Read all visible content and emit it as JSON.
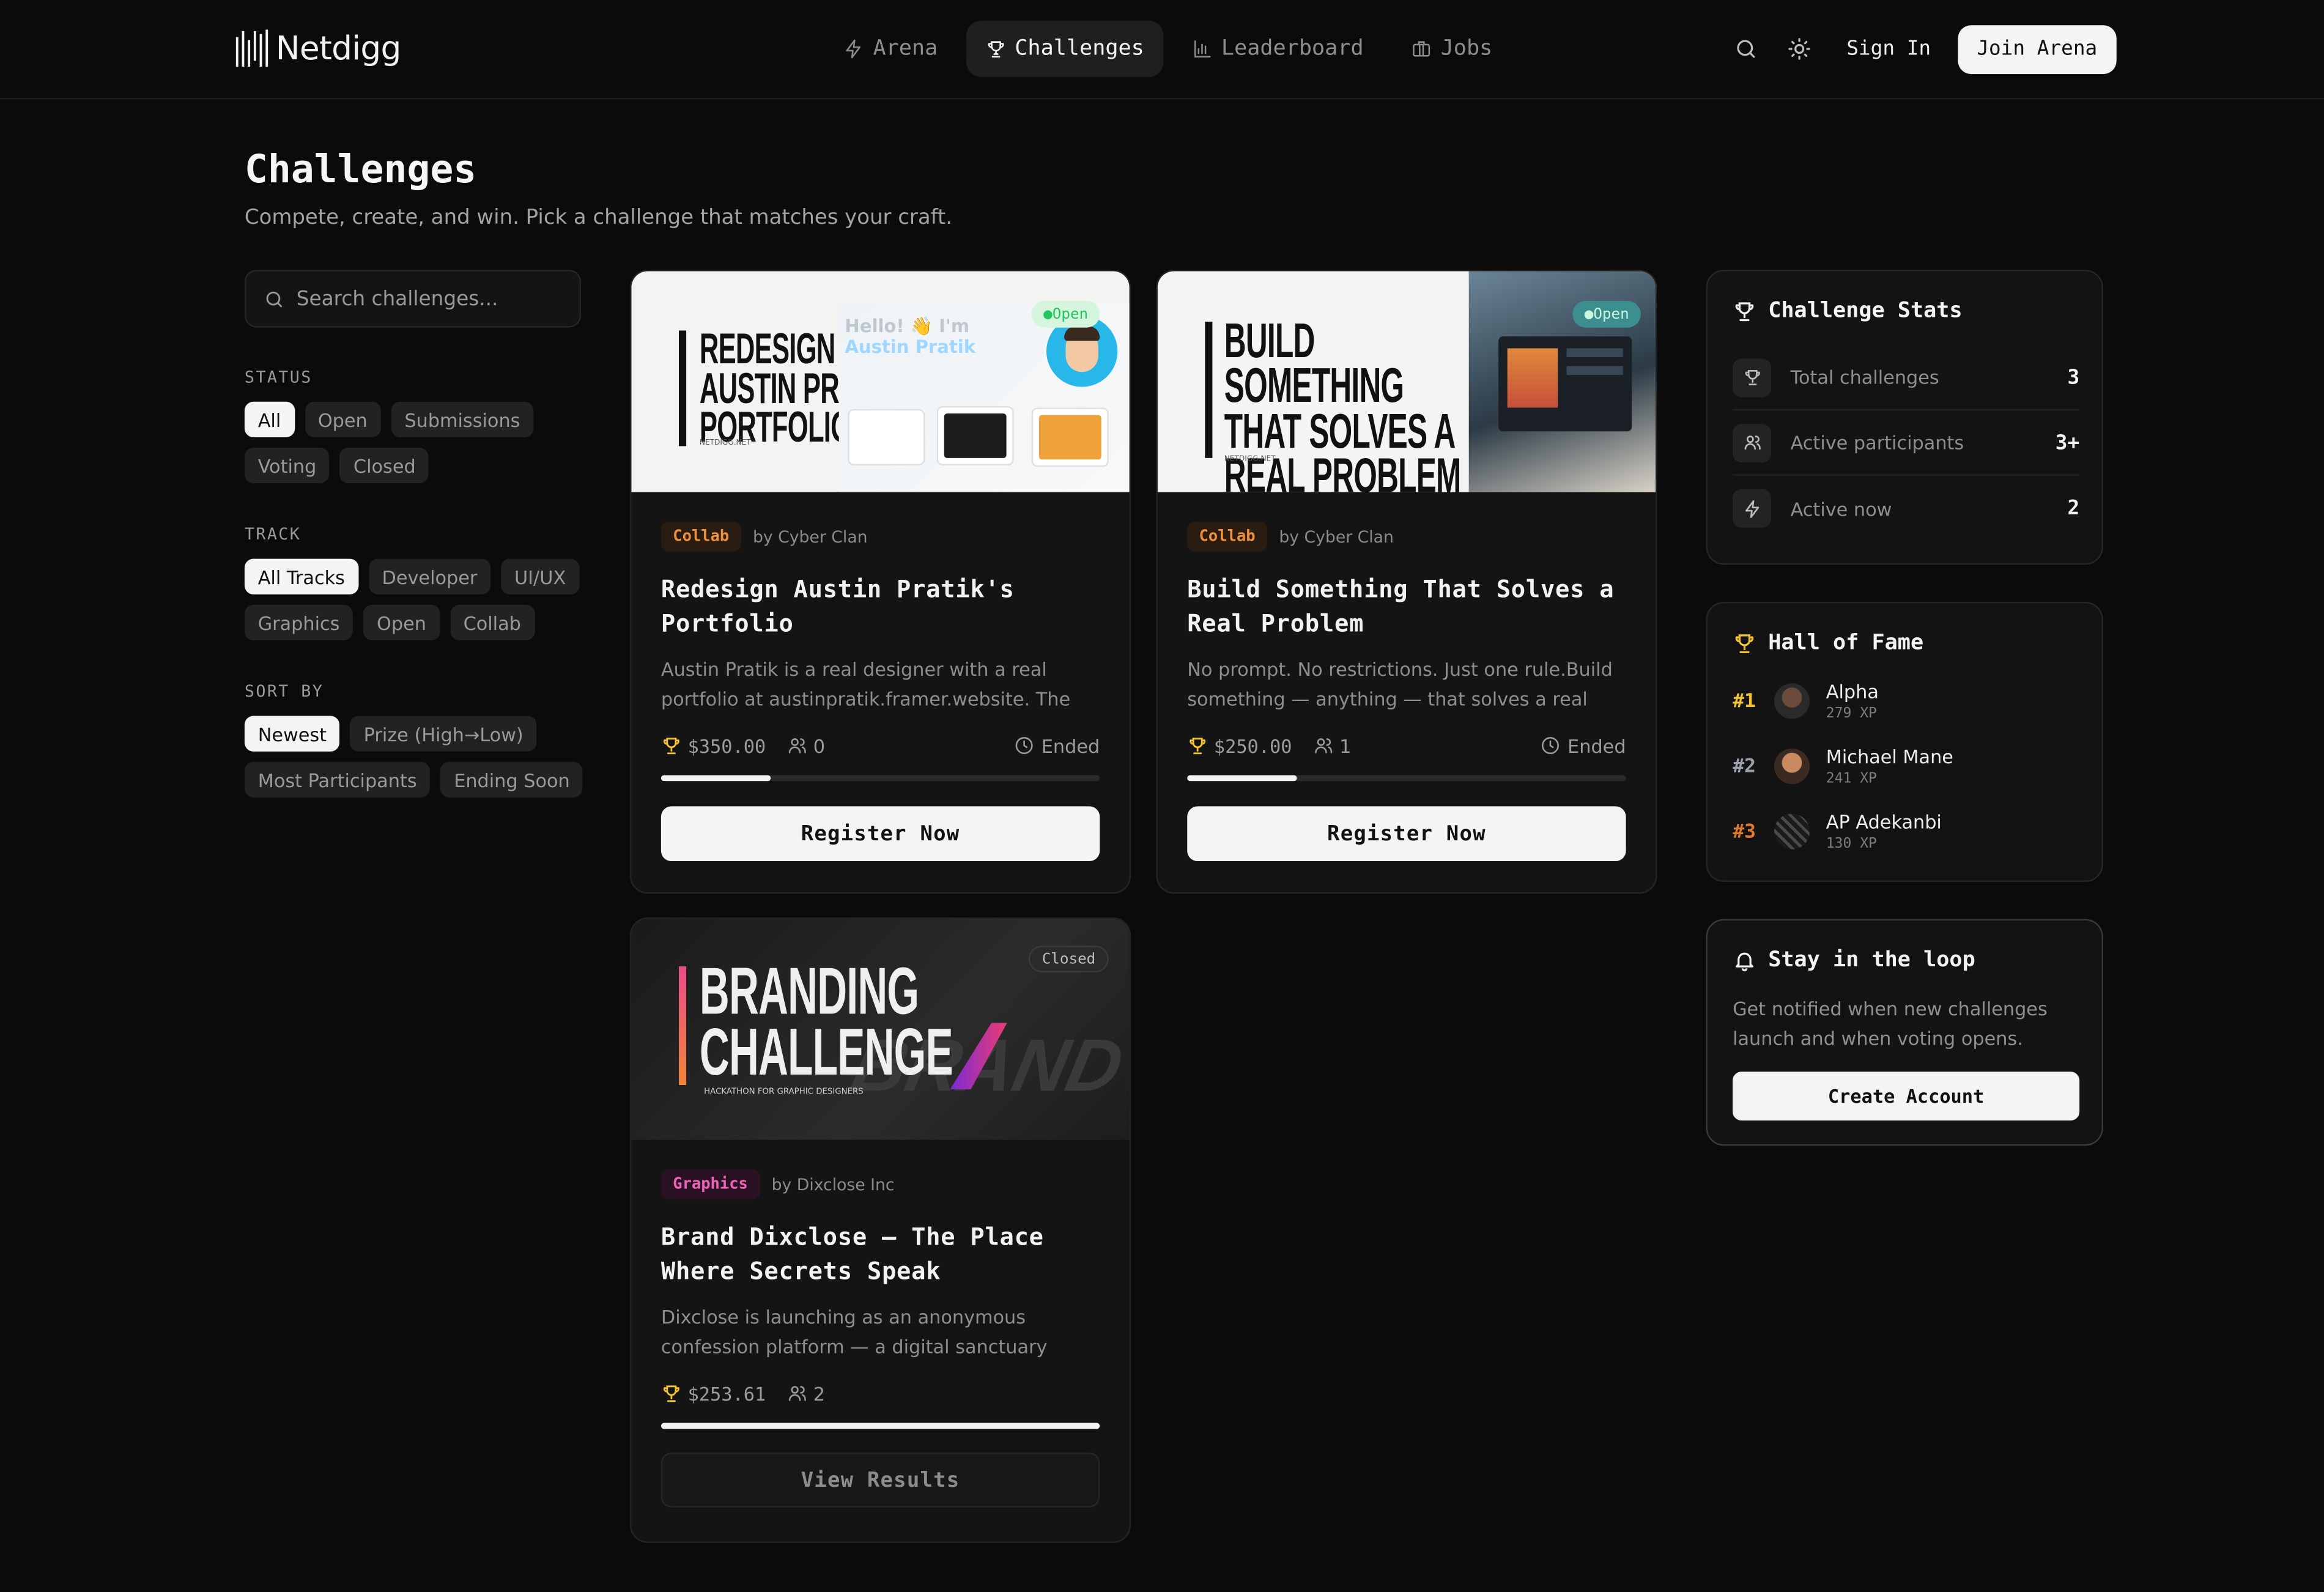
{
  "header": {
    "logo": "Netdigg",
    "nav": [
      {
        "label": "Arena",
        "icon": "bolt-icon"
      },
      {
        "label": "Challenges",
        "icon": "trophy-icon"
      },
      {
        "label": "Leaderboard",
        "icon": "bar-chart-icon"
      },
      {
        "label": "Jobs",
        "icon": "briefcase-icon"
      }
    ],
    "sign_in": "Sign In",
    "join": "Join Arena"
  },
  "page": {
    "title": "Challenges",
    "subtitle": "Compete, create, and win. Pick a challenge that matches your craft."
  },
  "sidebar": {
    "search_placeholder": "Search challenges...",
    "status": {
      "label": "STATUS",
      "options": [
        "All",
        "Open",
        "Submissions",
        "Voting",
        "Closed"
      ],
      "selected": "All"
    },
    "track": {
      "label": "TRACK",
      "options": [
        "All Tracks",
        "Developer",
        "UI/UX",
        "Graphics",
        "Open",
        "Collab"
      ],
      "selected": "All Tracks"
    },
    "sort": {
      "label": "SORT BY",
      "options": [
        "Newest",
        "Prize (High→Low)",
        "Most Participants",
        "Ending Soon"
      ],
      "selected": "Newest"
    }
  },
  "cards": [
    {
      "tag": "Collab",
      "by": "by Cyber Clan",
      "title": "Redesign Austin Pratik's Portfolio",
      "desc": "Austin Pratik is a real designer with a real portfolio at austinpratik.framer.website. The site works. It...",
      "prize": "$350.00",
      "participants": "0",
      "status": "Ended",
      "progress": 0.25,
      "button": "Register Now",
      "image": {
        "lines": [
          "REDESIGN",
          "AUSTIN PRATIK'S",
          "PORTFOLIO"
        ],
        "site": "NETDIGG.NET",
        "hello": "Hello! 👋 I'm",
        "name": "Austin Pratik",
        "badge": "Open"
      }
    },
    {
      "tag": "Collab",
      "by": "by Cyber Clan",
      "title": "Build Something That Solves a Real Problem",
      "desc": "No prompt. No restrictions. Just one rule.Build something — anything — that solves a real proble...",
      "prize": "$250.00",
      "participants": "1",
      "status": "Ended",
      "progress": 0.25,
      "button": "Register Now",
      "image": {
        "lines": [
          "BUILD SOMETHING",
          "THAT SOLVES A",
          "REAL PROBLEM"
        ],
        "site": "NETDIGG.NET",
        "badge": "Open"
      }
    },
    {
      "tag": "Graphics",
      "by": "by Dixclose Inc",
      "title": "Brand Dixclose — The Place Where Secrets Speak",
      "desc": "Dixclose is launching as an anonymous confession platform — a digital sanctuary where people share...",
      "prize": "$253.61",
      "participants": "2",
      "status": "",
      "progress": 1.0,
      "button": "View Results",
      "image": {
        "lines": [
          "BRANDING",
          "CHALLENGE"
        ],
        "sub": "HACKATHON FOR GRAPHIC DESIGNERS",
        "badge": "Closed",
        "bg_word": "BRAND"
      }
    }
  ],
  "stats": {
    "title": "Challenge Stats",
    "rows": [
      {
        "label": "Total challenges",
        "value": "3",
        "icon": "trophy-icon"
      },
      {
        "label": "Active participants",
        "value": "3+",
        "icon": "users-icon"
      },
      {
        "label": "Active now",
        "value": "2",
        "icon": "bolt-icon"
      }
    ]
  },
  "hall_of_fame": {
    "title": "Hall of Fame",
    "entries": [
      {
        "rank": "#1",
        "name": "Alpha",
        "xp": "279 XP",
        "color": "#f4c430"
      },
      {
        "rank": "#2",
        "name": "Michael Mane",
        "xp": "241 XP",
        "color": "#9ca3af"
      },
      {
        "rank": "#3",
        "name": "AP Adekanbi",
        "xp": "130 XP",
        "color": "#e07a2f"
      }
    ]
  },
  "loop": {
    "title": "Stay in the loop",
    "desc": "Get notified when new challenges launch and when voting opens.",
    "button": "Create Account"
  },
  "colors": {
    "accent_gold": "#f4c430",
    "collab": "#f0913a",
    "graphics": "#ee62b8",
    "open_green": "#22c55e"
  }
}
